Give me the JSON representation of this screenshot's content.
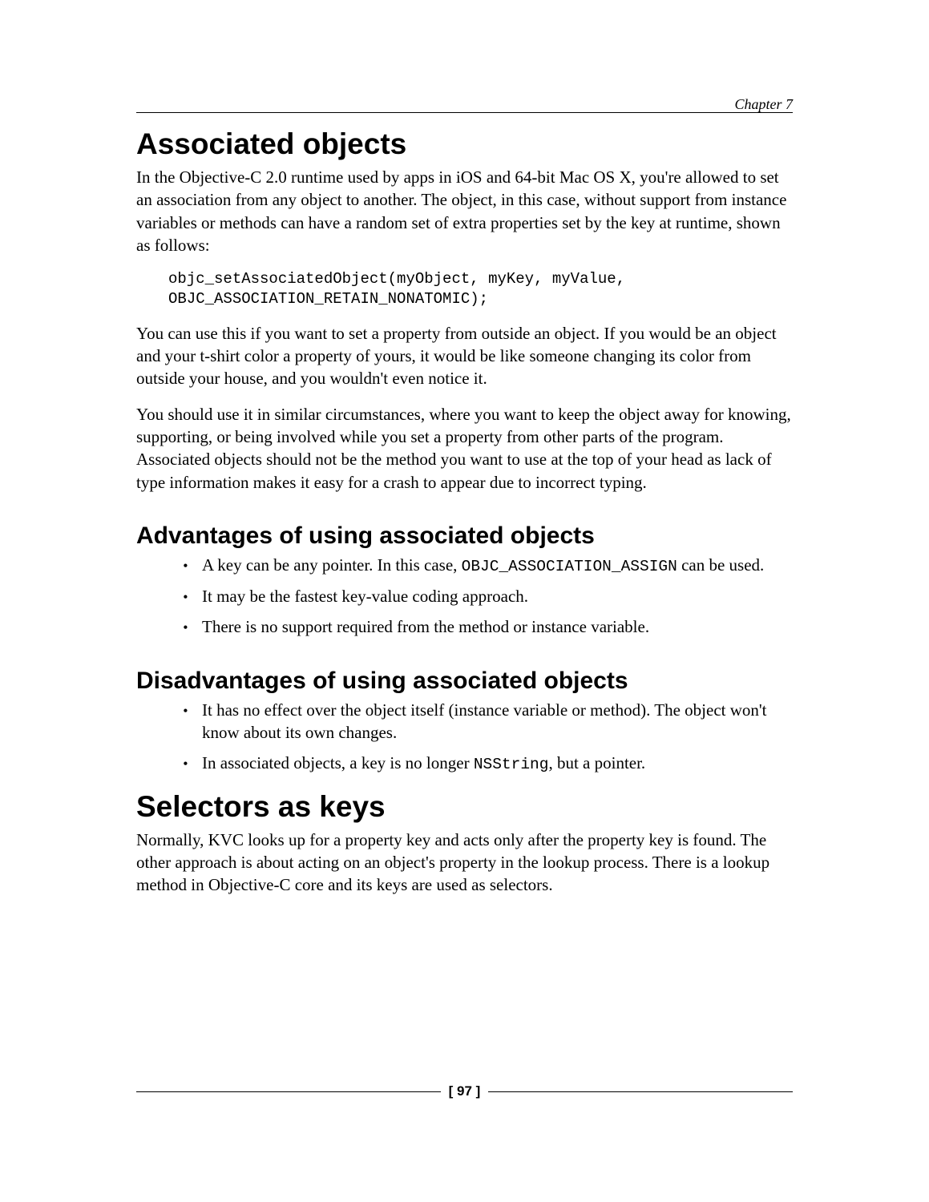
{
  "header": {
    "chapter_label": "Chapter 7"
  },
  "section1": {
    "heading": "Associated objects",
    "para1": "In the Objective-C 2.0 runtime used by apps in iOS and 64-bit Mac OS X, you're allowed to set an association from any object to another. The object, in this case, without support from instance variables or methods can have a random set of extra properties set by the key at runtime, shown as follows:",
    "code": "objc_setAssociatedObject(myObject, myKey, myValue,\nOBJC_ASSOCIATION_RETAIN_NONATOMIC);",
    "para2": "You can use this if you want to set a property from outside an object. If you would be an object and your t-shirt color a property of yours, it would be like someone changing its color from outside your house, and you wouldn't even notice it.",
    "para3": "You should use it in similar circumstances, where you want to keep the object away for knowing, supporting, or being involved while you set a property from other parts of the program. Associated objects should not be the method you want to use at the top of your head as lack of type information makes it easy for a crash to appear due to incorrect typing."
  },
  "section2": {
    "heading": "Advantages of using associated objects",
    "items": {
      "a_pre": "A key can be any pointer. In this case, ",
      "a_code": "OBJC_ASSOCIATION_ASSIGN",
      "a_post": " can be used.",
      "b": "It may be the fastest key-value coding approach.",
      "c": "There is no support required from the method or instance variable."
    }
  },
  "section3": {
    "heading": "Disadvantages of using associated objects",
    "items": {
      "a": "It has no effect over the object itself (instance variable or method). The object won't know about its own changes.",
      "b_pre": "In associated objects, a key is no longer ",
      "b_code": "NSString",
      "b_post": ", but a pointer."
    }
  },
  "section4": {
    "heading": "Selectors as keys",
    "para1": "Normally, KVC looks up for a property key and acts only after the property key is found. The other approach is about acting on an object's property in the lookup process. There is a lookup method in Objective-C core and its keys are used as selectors."
  },
  "footer": {
    "page_number": "[ 97 ]"
  }
}
